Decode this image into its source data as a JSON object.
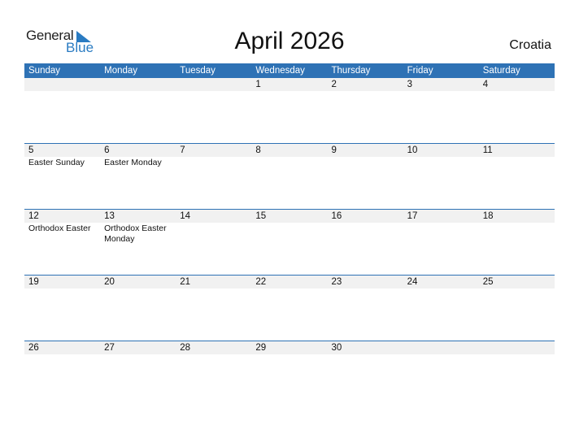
{
  "logo": {
    "line1": "General",
    "line2": "Blue"
  },
  "title": "April 2026",
  "country": "Croatia",
  "colors": {
    "accent": "#2e72b5",
    "band": "#f1f1f1"
  },
  "weekdays": [
    "Sunday",
    "Monday",
    "Tuesday",
    "Wednesday",
    "Thursday",
    "Friday",
    "Saturday"
  ],
  "weeks": [
    {
      "days": [
        {
          "num": "",
          "event": ""
        },
        {
          "num": "",
          "event": ""
        },
        {
          "num": "",
          "event": ""
        },
        {
          "num": "1",
          "event": ""
        },
        {
          "num": "2",
          "event": ""
        },
        {
          "num": "3",
          "event": ""
        },
        {
          "num": "4",
          "event": ""
        }
      ]
    },
    {
      "days": [
        {
          "num": "5",
          "event": "Easter Sunday"
        },
        {
          "num": "6",
          "event": "Easter Monday"
        },
        {
          "num": "7",
          "event": ""
        },
        {
          "num": "8",
          "event": ""
        },
        {
          "num": "9",
          "event": ""
        },
        {
          "num": "10",
          "event": ""
        },
        {
          "num": "11",
          "event": ""
        }
      ]
    },
    {
      "days": [
        {
          "num": "12",
          "event": "Orthodox Easter"
        },
        {
          "num": "13",
          "event": "Orthodox Easter Monday"
        },
        {
          "num": "14",
          "event": ""
        },
        {
          "num": "15",
          "event": ""
        },
        {
          "num": "16",
          "event": ""
        },
        {
          "num": "17",
          "event": ""
        },
        {
          "num": "18",
          "event": ""
        }
      ]
    },
    {
      "days": [
        {
          "num": "19",
          "event": ""
        },
        {
          "num": "20",
          "event": ""
        },
        {
          "num": "21",
          "event": ""
        },
        {
          "num": "22",
          "event": ""
        },
        {
          "num": "23",
          "event": ""
        },
        {
          "num": "24",
          "event": ""
        },
        {
          "num": "25",
          "event": ""
        }
      ]
    },
    {
      "days": [
        {
          "num": "26",
          "event": ""
        },
        {
          "num": "27",
          "event": ""
        },
        {
          "num": "28",
          "event": ""
        },
        {
          "num": "29",
          "event": ""
        },
        {
          "num": "30",
          "event": ""
        },
        {
          "num": "",
          "event": ""
        },
        {
          "num": "",
          "event": ""
        }
      ]
    }
  ]
}
